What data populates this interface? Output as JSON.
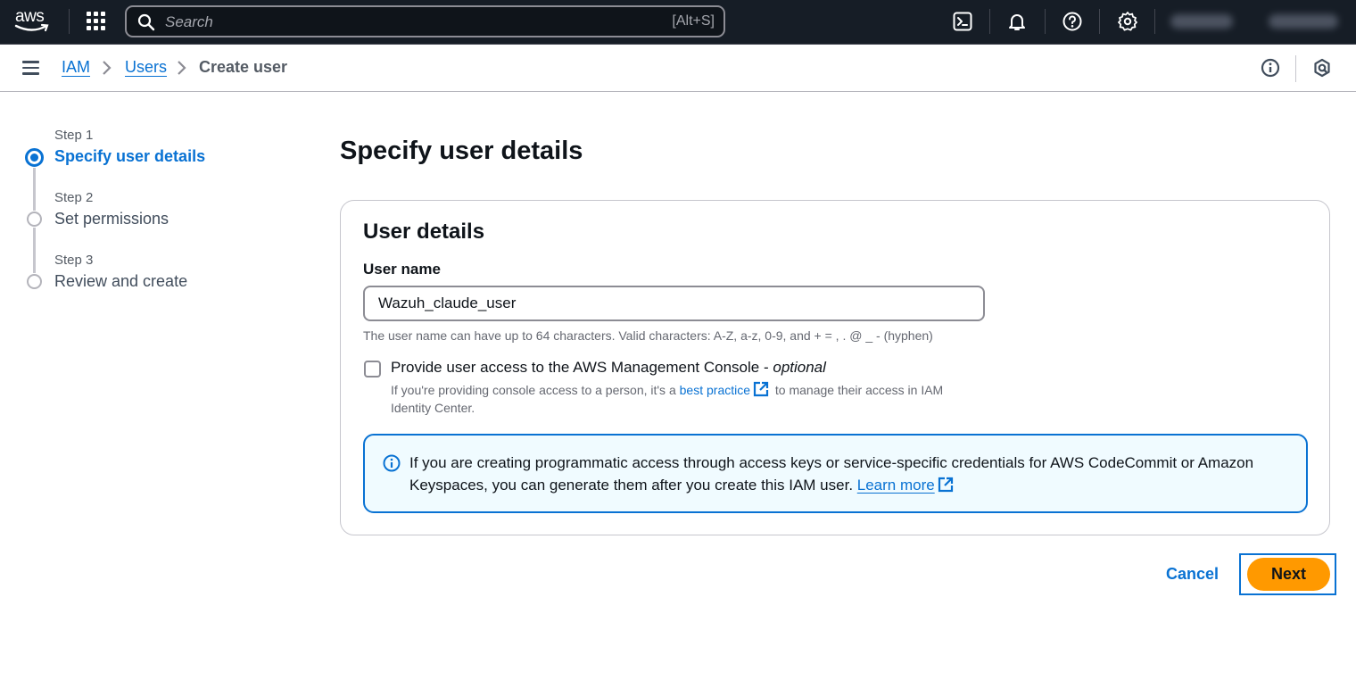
{
  "topnav": {
    "logo_text": "aws",
    "search": {
      "placeholder": "Search",
      "shortcut": "[Alt+S]"
    },
    "icons": [
      "cloudshell-icon",
      "notifications-bell-icon",
      "help-icon",
      "settings-gear-icon"
    ],
    "account_redacted": true,
    "region_redacted": true
  },
  "breadcrumb": {
    "items": [
      {
        "label": "IAM",
        "link": true
      },
      {
        "label": "Users",
        "link": true
      },
      {
        "label": "Create user",
        "link": false
      }
    ]
  },
  "steps": [
    {
      "step": "Step 1",
      "title": "Specify user details",
      "active": true
    },
    {
      "step": "Step 2",
      "title": "Set permissions",
      "active": false
    },
    {
      "step": "Step 3",
      "title": "Review and create",
      "active": false
    }
  ],
  "main": {
    "page_title": "Specify user details",
    "container_title": "User details",
    "user_name_label": "User name",
    "user_name_value": "Wazuh_claude_user",
    "user_name_constraint": "The user name can have up to 64 characters. Valid characters: A-Z, a-z, 0-9, and + = , . @ _ - (hyphen)",
    "console_access": {
      "checked": false,
      "label": "Provide user access to the AWS Management Console - ",
      "label_optional": "optional",
      "desc_before": "If you're providing console access to a person, it's a ",
      "desc_link": "best practice",
      "desc_after": " to manage their access in IAM Identity Center."
    },
    "info_alert": {
      "text": "If you are creating programmatic access through access keys or service-specific credentials for AWS CodeCommit or Amazon Keyspaces, you can generate them after you create this IAM user. ",
      "link": "Learn more"
    }
  },
  "actions": {
    "cancel": "Cancel",
    "next": "Next"
  },
  "colors": {
    "accent": "#0972d3",
    "primary_button": "#ff9900",
    "topnav_bg": "#161d26",
    "info_bg": "#f0fbff"
  }
}
